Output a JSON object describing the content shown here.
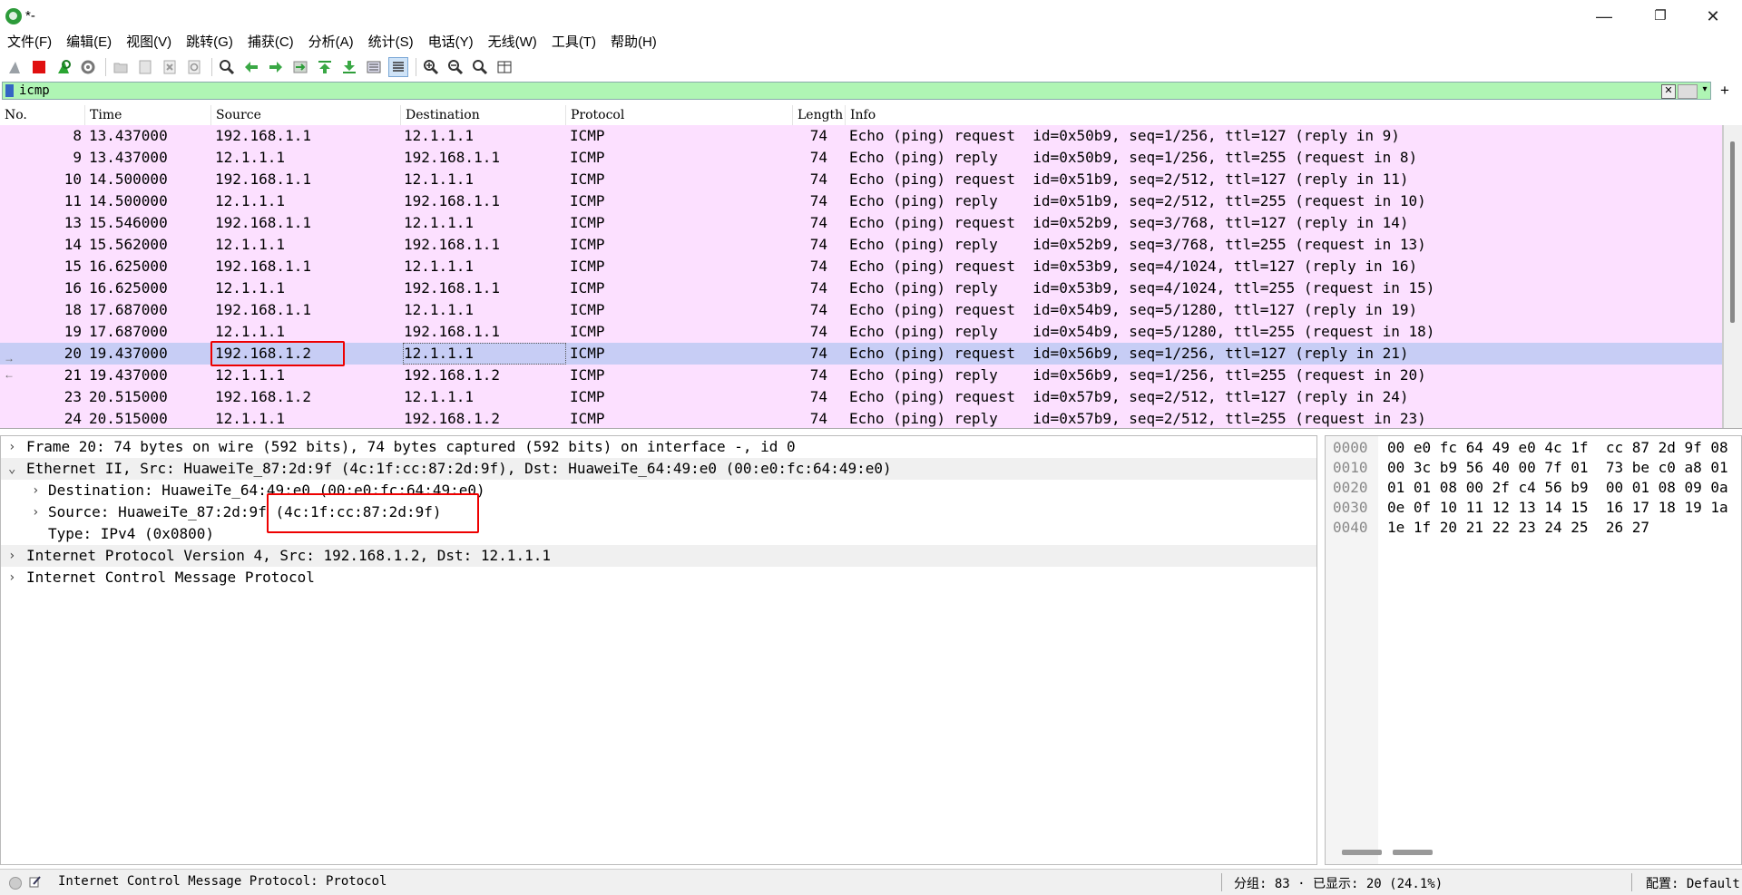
{
  "window": {
    "title": "*-",
    "controls": {
      "minimize": "—",
      "maximize": "❐",
      "close": "✕"
    }
  },
  "menu": [
    "文件(F)",
    "编辑(E)",
    "视图(V)",
    "跳转(G)",
    "捕获(C)",
    "分析(A)",
    "统计(S)",
    "电话(Y)",
    "无线(W)",
    "工具(T)",
    "帮助(H)"
  ],
  "toolbar": {
    "buttons": [
      "shark-fin-start-icon",
      "stop-capture-icon",
      "restart-capture-icon",
      "capture-options-icon",
      "open-file-icon",
      "save-file-icon",
      "close-file-icon",
      "reload-icon",
      "find-packet-icon",
      "go-back-icon",
      "go-forward-icon",
      "go-to-packet-icon",
      "go-first-icon",
      "go-last-icon",
      "autoscroll-icon",
      "colorize-icon",
      "zoom-in-icon",
      "zoom-out-icon",
      "zoom-normal-icon",
      "resize-columns-icon"
    ],
    "colors": {
      "stop": "#e01010",
      "green": "#2aa532",
      "arrow": "#2e9e3a"
    }
  },
  "filter": {
    "value": "icmp",
    "background": "#aff5b4"
  },
  "packet_list": {
    "columns": [
      "No.",
      "Time",
      "Source",
      "Destination",
      "Protocol",
      "Length",
      "Info"
    ],
    "row_color": "#fce0ff",
    "selected_color": "#c7cdf5",
    "rows": [
      {
        "no": "8",
        "time": "13.437000",
        "src": "192.168.1.1",
        "dst": "12.1.1.1",
        "proto": "ICMP",
        "len": "74",
        "info": "Echo (ping) request  id=0x50b9, seq=1/256, ttl=127 (reply in 9)"
      },
      {
        "no": "9",
        "time": "13.437000",
        "src": "12.1.1.1",
        "dst": "192.168.1.1",
        "proto": "ICMP",
        "len": "74",
        "info": "Echo (ping) reply    id=0x50b9, seq=1/256, ttl=255 (request in 8)"
      },
      {
        "no": "10",
        "time": "14.500000",
        "src": "192.168.1.1",
        "dst": "12.1.1.1",
        "proto": "ICMP",
        "len": "74",
        "info": "Echo (ping) request  id=0x51b9, seq=2/512, ttl=127 (reply in 11)"
      },
      {
        "no": "11",
        "time": "14.500000",
        "src": "12.1.1.1",
        "dst": "192.168.1.1",
        "proto": "ICMP",
        "len": "74",
        "info": "Echo (ping) reply    id=0x51b9, seq=2/512, ttl=255 (request in 10)"
      },
      {
        "no": "13",
        "time": "15.546000",
        "src": "192.168.1.1",
        "dst": "12.1.1.1",
        "proto": "ICMP",
        "len": "74",
        "info": "Echo (ping) request  id=0x52b9, seq=3/768, ttl=127 (reply in 14)"
      },
      {
        "no": "14",
        "time": "15.562000",
        "src": "12.1.1.1",
        "dst": "192.168.1.1",
        "proto": "ICMP",
        "len": "74",
        "info": "Echo (ping) reply    id=0x52b9, seq=3/768, ttl=255 (request in 13)"
      },
      {
        "no": "15",
        "time": "16.625000",
        "src": "192.168.1.1",
        "dst": "12.1.1.1",
        "proto": "ICMP",
        "len": "74",
        "info": "Echo (ping) request  id=0x53b9, seq=4/1024, ttl=127 (reply in 16)"
      },
      {
        "no": "16",
        "time": "16.625000",
        "src": "12.1.1.1",
        "dst": "192.168.1.1",
        "proto": "ICMP",
        "len": "74",
        "info": "Echo (ping) reply    id=0x53b9, seq=4/1024, ttl=255 (request in 15)"
      },
      {
        "no": "18",
        "time": "17.687000",
        "src": "192.168.1.1",
        "dst": "12.1.1.1",
        "proto": "ICMP",
        "len": "74",
        "info": "Echo (ping) request  id=0x54b9, seq=5/1280, ttl=127 (reply in 19)"
      },
      {
        "no": "19",
        "time": "17.687000",
        "src": "12.1.1.1",
        "dst": "192.168.1.1",
        "proto": "ICMP",
        "len": "74",
        "info": "Echo (ping) reply    id=0x54b9, seq=5/1280, ttl=255 (request in 18)"
      },
      {
        "no": "20",
        "time": "19.437000",
        "src": "192.168.1.2",
        "dst": "12.1.1.1",
        "proto": "ICMP",
        "len": "74",
        "info": "Echo (ping) request  id=0x56b9, seq=1/256, ttl=127 (reply in 21)",
        "selected": true
      },
      {
        "no": "21",
        "time": "19.437000",
        "src": "12.1.1.1",
        "dst": "192.168.1.2",
        "proto": "ICMP",
        "len": "74",
        "info": "Echo (ping) reply    id=0x56b9, seq=1/256, ttl=255 (request in 20)"
      },
      {
        "no": "23",
        "time": "20.515000",
        "src": "192.168.1.2",
        "dst": "12.1.1.1",
        "proto": "ICMP",
        "len": "74",
        "info": "Echo (ping) request  id=0x57b9, seq=2/512, ttl=127 (reply in 24)"
      },
      {
        "no": "24",
        "time": "20.515000",
        "src": "12.1.1.1",
        "dst": "192.168.1.2",
        "proto": "ICMP",
        "len": "74",
        "info": "Echo (ping) reply    id=0x57b9, seq=2/512, ttl=255 (request in 23)"
      }
    ]
  },
  "detail_tree": [
    {
      "level": 0,
      "expanded": false,
      "text": "Frame 20: 74 bytes on wire (592 bits), 74 bytes captured (592 bits) on interface -, id 0"
    },
    {
      "level": 0,
      "expanded": true,
      "text": "Ethernet II, Src: HuaweiTe_87:2d:9f (4c:1f:cc:87:2d:9f), Dst: HuaweiTe_64:49:e0 (00:e0:fc:64:49:e0)"
    },
    {
      "level": 1,
      "expanded": false,
      "text": "Destination: HuaweiTe_64:49:e0 (00:e0:fc:64:49:e0)"
    },
    {
      "level": 1,
      "expanded": false,
      "text": "Source: HuaweiTe_87:2d:9f (4c:1f:cc:87:2d:9f)"
    },
    {
      "level": 1,
      "leaf": true,
      "text": "Type: IPv4 (0x0800)"
    },
    {
      "level": 0,
      "expanded": false,
      "text": "Internet Protocol Version 4, Src: 192.168.1.2, Dst: 12.1.1.1"
    },
    {
      "level": 0,
      "expanded": false,
      "text": "Internet Control Message Protocol"
    }
  ],
  "bytes": [
    {
      "offset": "0000",
      "hex": "00 e0 fc 64 49 e0 4c 1f  cc 87 2d 9f 08"
    },
    {
      "offset": "0010",
      "hex": "00 3c b9 56 40 00 7f 01  73 be c0 a8 01"
    },
    {
      "offset": "0020",
      "hex": "01 01 08 00 2f c4 56 b9  00 01 08 09 0a"
    },
    {
      "offset": "0030",
      "hex": "0e 0f 10 11 12 13 14 15  16 17 18 19 1a"
    },
    {
      "offset": "0040",
      "hex": "1e 1f 20 21 22 23 24 25  26 27"
    }
  ],
  "status": {
    "text": "Internet Control Message Protocol: Protocol",
    "stats": "分组: 83 · 已显示: 20 (24.1%)",
    "profile": "配置: Default"
  },
  "arrow_chars": {
    "collapsed": "›",
    "expanded": "⌄"
  }
}
